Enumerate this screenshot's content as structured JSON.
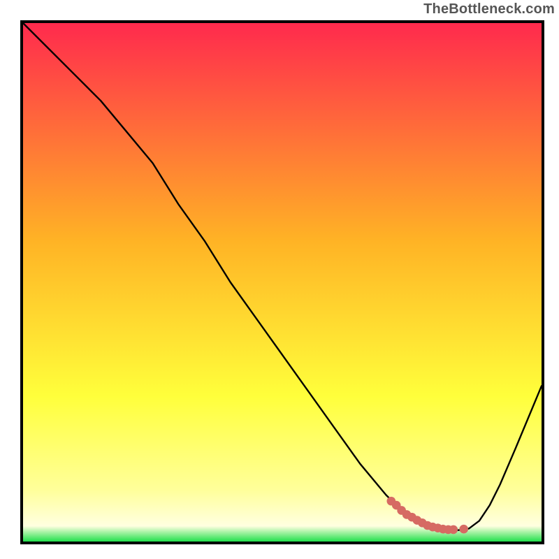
{
  "watermark": "TheBottleneck.com",
  "colors": {
    "red": "#ff2a4d",
    "orange": "#ffb325",
    "yellow": "#ffff3b",
    "pale_yellow": "#ffff9a",
    "green": "#22e04c",
    "curve": "#000000",
    "marker": "#d66a63",
    "border": "#000000"
  },
  "chart_data": {
    "type": "line",
    "title": "",
    "xlabel": "",
    "ylabel": "",
    "xlim": [
      0,
      100
    ],
    "ylim": [
      0,
      100
    ],
    "series": [
      {
        "name": "bottleneck-curve",
        "x": [
          0,
          5,
          10,
          15,
          20,
          25,
          30,
          35,
          40,
          45,
          50,
          55,
          60,
          65,
          70,
          72,
          74,
          76,
          78,
          80,
          82,
          84,
          86,
          88,
          90,
          92,
          95,
          100
        ],
        "y": [
          100,
          95,
          90,
          85,
          79,
          73,
          65,
          58,
          50,
          43,
          36,
          29,
          22,
          15,
          9,
          7,
          5,
          4,
          3,
          2.5,
          2.2,
          2.2,
          2.5,
          4,
          7,
          11,
          18,
          30
        ]
      }
    ],
    "markers": {
      "name": "highlight",
      "x": [
        71,
        72,
        73,
        74,
        75,
        76,
        77,
        78,
        79,
        80,
        81,
        82,
        83,
        85
      ],
      "y": [
        7.8,
        7.0,
        6.0,
        5.2,
        4.7,
        4.1,
        3.6,
        3.1,
        2.8,
        2.6,
        2.4,
        2.3,
        2.3,
        2.4
      ]
    },
    "gradient_stops": [
      {
        "offset": 0.0,
        "color": "#ff2a4d"
      },
      {
        "offset": 0.42,
        "color": "#ffb325"
      },
      {
        "offset": 0.72,
        "color": "#ffff3b"
      },
      {
        "offset": 0.9,
        "color": "#ffff9a"
      },
      {
        "offset": 0.97,
        "color": "#ffffe0"
      },
      {
        "offset": 1.0,
        "color": "#22e04c"
      }
    ]
  }
}
